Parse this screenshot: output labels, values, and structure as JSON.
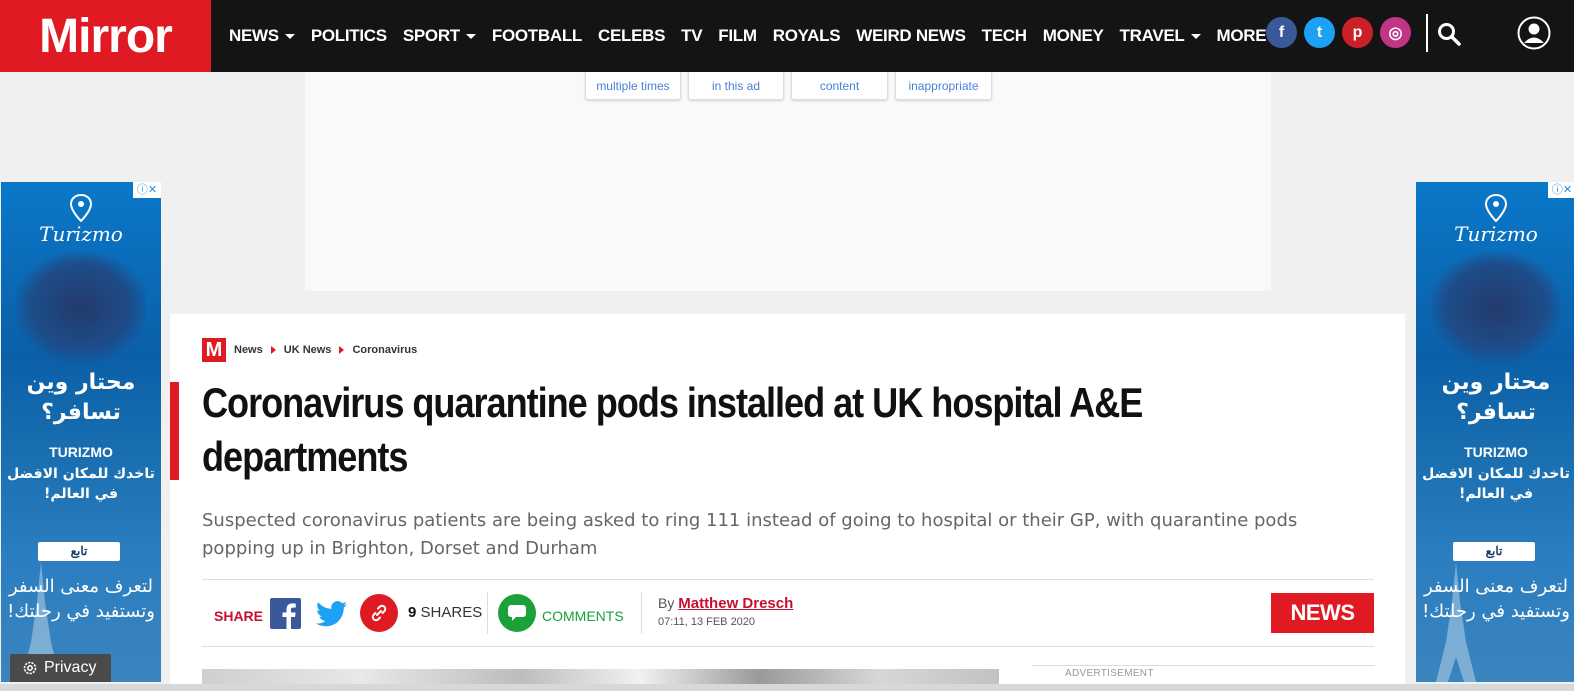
{
  "header": {
    "logo": "Mirror",
    "nav": [
      {
        "label": "NEWS",
        "dropdown": true
      },
      {
        "label": "POLITICS",
        "dropdown": false
      },
      {
        "label": "SPORT",
        "dropdown": true
      },
      {
        "label": "FOOTBALL",
        "dropdown": false
      },
      {
        "label": "CELEBS",
        "dropdown": false
      },
      {
        "label": "TV",
        "dropdown": false
      },
      {
        "label": "FILM",
        "dropdown": false
      },
      {
        "label": "ROYALS",
        "dropdown": false
      },
      {
        "label": "WEIRD NEWS",
        "dropdown": false
      },
      {
        "label": "TECH",
        "dropdown": false
      },
      {
        "label": "MONEY",
        "dropdown": false
      },
      {
        "label": "TRAVEL",
        "dropdown": true
      },
      {
        "label": "MORE",
        "dropdown": true
      }
    ],
    "social": [
      {
        "icon": "facebook-icon",
        "glyph": "f",
        "color": "#3b5998"
      },
      {
        "icon": "twitter-icon",
        "glyph": "t",
        "color": "#1da1f2"
      },
      {
        "icon": "pinterest-icon",
        "glyph": "p",
        "color": "#cb2027"
      },
      {
        "icon": "instagram-icon",
        "glyph": "◎",
        "color": "#c13584"
      }
    ]
  },
  "ad_feedback": {
    "buttons": [
      "multiple times",
      "in this ad",
      "content",
      "inappropriate"
    ]
  },
  "side_ad": {
    "brand": "Turizmo",
    "headline_ar": "محتار وين تسافر؟",
    "brand_caps": "TURIZMO",
    "sub_ar": "تاخدك للمكان الافضل في العالم!",
    "follow": "تابع",
    "tagline_ar": "لتعرف معنى السفر وتستفيد في رحلتك!",
    "adchoices": "ⓘ✕"
  },
  "privacy": {
    "label": "Privacy"
  },
  "article": {
    "breadcrumbs": [
      "News",
      "UK News",
      "Coronavirus"
    ],
    "mlogo": "M",
    "headline": "Coronavirus quarantine pods installed at UK hospital A&E departments",
    "standfirst": "Suspected coronavirus patients are being asked to ring 111 instead of going to hospital or their GP, with quarantine pods popping up in Brighton, Dorset and Durham",
    "share_label": "SHARE",
    "share_count": "9",
    "shares_label": "SHARES",
    "comments_label": "COMMENTS",
    "by": "By",
    "author": "Matthew Dresch",
    "date": "07:11, 13 FEB 2020",
    "section_badge": "NEWS",
    "advertisement_label": "ADVERTISEMENT"
  }
}
